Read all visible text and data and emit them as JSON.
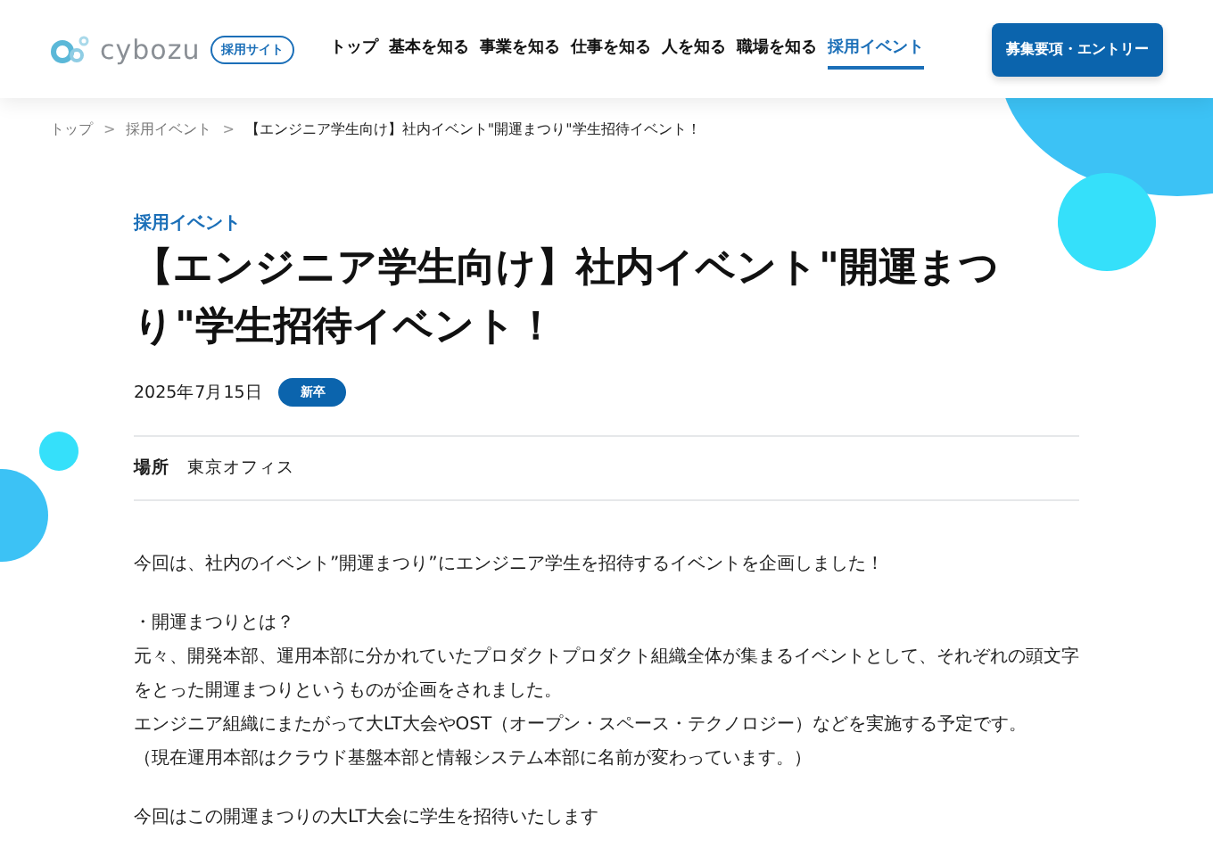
{
  "header": {
    "logo_text": "cybozu",
    "site_badge": "採用サイト",
    "nav": [
      {
        "label": "トップ",
        "selected": false
      },
      {
        "label": "基本を知る",
        "selected": false
      },
      {
        "label": "事業を知る",
        "selected": false
      },
      {
        "label": "仕事を知る",
        "selected": false
      },
      {
        "label": "人を知る",
        "selected": false
      },
      {
        "label": "職場を知る",
        "selected": false
      },
      {
        "label": "採用イベント",
        "selected": true
      }
    ],
    "cta": "募集要項・エントリー"
  },
  "breadcrumb": {
    "separator": ">",
    "items": [
      "トップ",
      "採用イベント",
      "【エンジニア学生向け】社内イベント\"開運まつり\"学生招待イベント！"
    ]
  },
  "article": {
    "category": "採用イベント",
    "title": "【エンジニア学生向け】社内イベント\"開運まつり\"学生招待イベント！",
    "date": "2025年7月15日",
    "tag": "新卒",
    "place_label": "場所",
    "place": "東京オフィス",
    "paragraphs": [
      [
        "今回は、社内のイベント”開運まつり”にエンジニア学生を招待するイベントを企画しました！"
      ],
      [
        "・開運まつりとは？",
        "元々、開発本部、運用本部に分かれていたプロダクトプロダクト組織全体が集まるイベントとして、それぞれの頭文字をとった開運まつりというものが企画をされました。",
        "エンジニア組織にまたがって大LT大会やOST（オープン・スペース・テクノロジー）などを実施する予定です。",
        "（現在運用本部はクラウド基盤本部と情報システム本部に名前が変わっています。）"
      ],
      [
        "今回はこの開運まつりの大LT大会に学生を招待いたします"
      ]
    ]
  }
}
